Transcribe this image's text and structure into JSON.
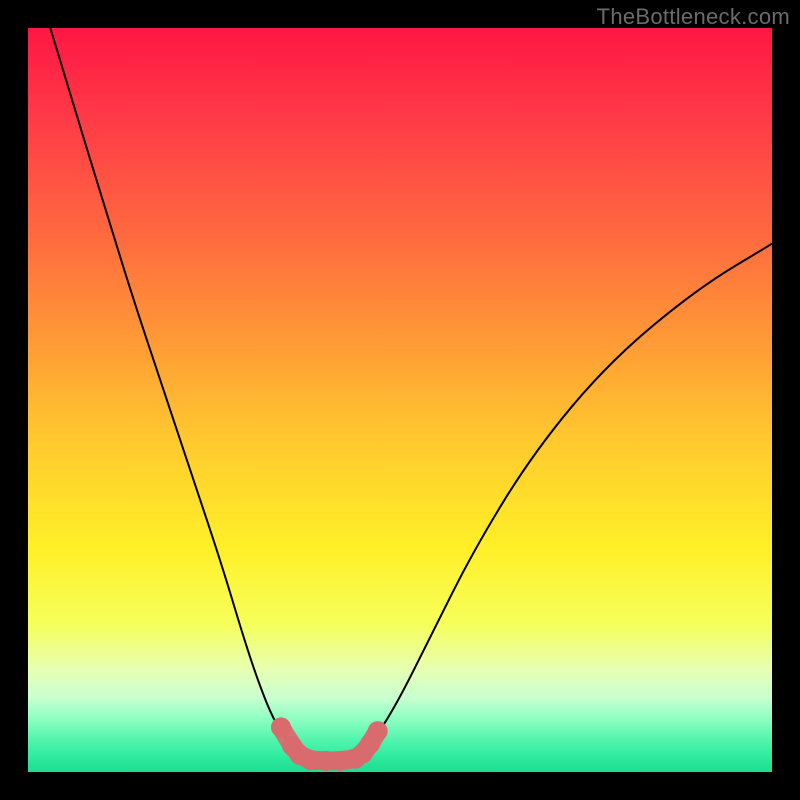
{
  "watermark": "TheBottleneck.com",
  "chart_data": {
    "type": "line",
    "title": "",
    "xlabel": "",
    "ylabel": "",
    "xlim": [
      0,
      100
    ],
    "ylim": [
      0,
      100
    ],
    "grid": false,
    "legend": false,
    "series": [
      {
        "name": "left-curve",
        "x": [
          3,
          6,
          10,
          14,
          18,
          22,
          26,
          29,
          31,
          33,
          35,
          36.5
        ],
        "y": [
          100,
          90,
          77,
          64,
          52,
          40,
          28,
          18,
          12,
          7,
          4,
          2.5
        ]
      },
      {
        "name": "right-curve",
        "x": [
          45,
          47,
          50,
          54,
          60,
          68,
          78,
          90,
          100
        ],
        "y": [
          2.5,
          5,
          10,
          18,
          30,
          43,
          55,
          65,
          71
        ]
      },
      {
        "name": "flat-bottom",
        "x": [
          36.5,
          38,
          40,
          42,
          44,
          45
        ],
        "y": [
          2.5,
          1.8,
          1.5,
          1.5,
          1.8,
          2.5
        ]
      }
    ],
    "markers": {
      "name": "pink-dots",
      "points": [
        {
          "x": 34.0,
          "y": 6.0
        },
        {
          "x": 35.5,
          "y": 3.5
        },
        {
          "x": 36.5,
          "y": 2.3
        },
        {
          "x": 38.0,
          "y": 1.6
        },
        {
          "x": 40.0,
          "y": 1.5
        },
        {
          "x": 42.0,
          "y": 1.5
        },
        {
          "x": 44.0,
          "y": 1.8
        },
        {
          "x": 45.0,
          "y": 2.5
        },
        {
          "x": 46.0,
          "y": 3.8
        },
        {
          "x": 47.0,
          "y": 5.5
        }
      ],
      "color": "#d96b6f",
      "radius": 10
    },
    "gradient_stops": [
      {
        "offset": 0.0,
        "color": "#ff1744"
      },
      {
        "offset": 0.12,
        "color": "#ff3a47"
      },
      {
        "offset": 0.28,
        "color": "#ff6a3f"
      },
      {
        "offset": 0.42,
        "color": "#ff9a36"
      },
      {
        "offset": 0.56,
        "color": "#ffcb2e"
      },
      {
        "offset": 0.7,
        "color": "#fff028"
      },
      {
        "offset": 0.8,
        "color": "#f6ff5a"
      },
      {
        "offset": 0.86,
        "color": "#e8ffb0"
      },
      {
        "offset": 0.9,
        "color": "#c9ffd0"
      },
      {
        "offset": 0.93,
        "color": "#8affc0"
      },
      {
        "offset": 0.96,
        "color": "#4cf3ab"
      },
      {
        "offset": 0.985,
        "color": "#28e89b"
      },
      {
        "offset": 1.0,
        "color": "#1fdc92"
      }
    ]
  }
}
